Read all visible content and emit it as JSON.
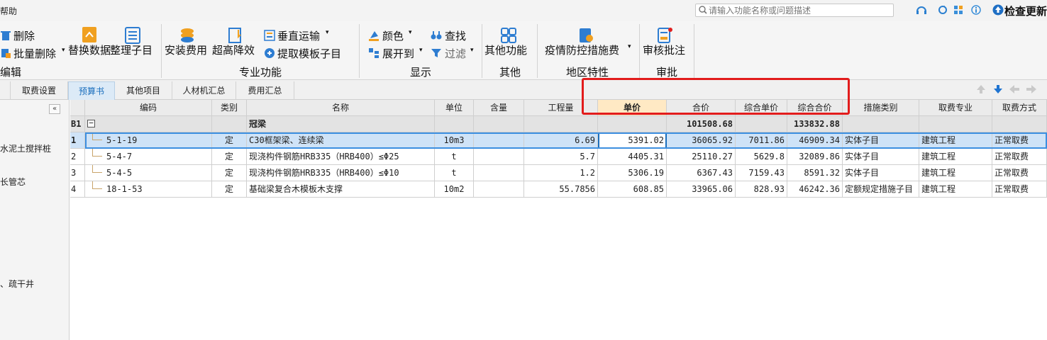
{
  "titlebar": {
    "left_text": "帮助",
    "search_placeholder": "请输入功能名称或问题描述",
    "check_update": "检查更新"
  },
  "ribbon": {
    "delete": "删除",
    "batch_delete": "批量删除",
    "replace_data": "替换数据",
    "organize_subitems": "整理子目",
    "install_cost": "安装费用",
    "height_reduction": "超高降效",
    "vertical_transport": "垂直运输",
    "extract_template": "提取模板子目",
    "color": "颜色",
    "expand_to": "展开到",
    "find": "查找",
    "filter": "过滤",
    "other_functions": "其他功能",
    "epidemic_measures": "疫情防控措施费",
    "review_approval": "审核批注",
    "groups": {
      "edit": "编辑",
      "professional": "专业功能",
      "display": "显示",
      "other": "其他",
      "regional": "地区特性",
      "approval": "审批"
    }
  },
  "tabs": [
    "取费设置",
    "预算书",
    "其他项目",
    "人材机汇总",
    "费用汇总"
  ],
  "left_panel": {
    "items": [
      "水泥土搅拌桩",
      "长管芯",
      "、疏干井"
    ]
  },
  "grid": {
    "headers": [
      "编码",
      "类别",
      "名称",
      "单位",
      "含量",
      "工程量",
      "单价",
      "合价",
      "综合单价",
      "综合合价",
      "措施类别",
      "取费专业",
      "取费方式"
    ],
    "group_row": {
      "id": "B1",
      "name": "冠梁",
      "total_price": "101508.68",
      "comprehensive_total": "133832.88"
    },
    "rows": [
      {
        "no": "1",
        "code": "5-1-19",
        "type": "定",
        "name": "C30框架梁、连续梁",
        "unit": "10m3",
        "qty": "6.69",
        "price": "5391.02",
        "total": "36065.92",
        "comp_unit": "7011.86",
        "comp_total": "46909.34",
        "measure": "实体子目",
        "specialty": "建筑工程",
        "fee_method": "正常取费"
      },
      {
        "no": "2",
        "code": "5-4-7",
        "type": "定",
        "name": "现浇构件钢筋HRB335（HRB400）≤Φ25",
        "unit": "t",
        "qty": "5.7",
        "price": "4405.31",
        "total": "25110.27",
        "comp_unit": "5629.8",
        "comp_total": "32089.86",
        "measure": "实体子目",
        "specialty": "建筑工程",
        "fee_method": "正常取费"
      },
      {
        "no": "3",
        "code": "5-4-5",
        "type": "定",
        "name": "现浇构件钢筋HRB335（HRB400）≤Φ10",
        "unit": "t",
        "qty": "1.2",
        "price": "5306.19",
        "total": "6367.43",
        "comp_unit": "7159.43",
        "comp_total": "8591.32",
        "measure": "实体子目",
        "specialty": "建筑工程",
        "fee_method": "正常取费"
      },
      {
        "no": "4",
        "code": "18-1-53",
        "type": "定",
        "name": "基础梁复合木模板木支撑",
        "unit": "10m2",
        "qty": "55.7856",
        "price": "608.85",
        "total": "33965.06",
        "comp_unit": "828.93",
        "comp_total": "46242.36",
        "measure": "定额规定措施子目",
        "specialty": "建筑工程",
        "fee_method": "正常取费"
      }
    ]
  },
  "colors": {
    "accent": "#1b6fbd",
    "highlight_box": "#e21c1c",
    "selected_row": "#cfe3f7",
    "price_header": "#ffe9c4"
  }
}
